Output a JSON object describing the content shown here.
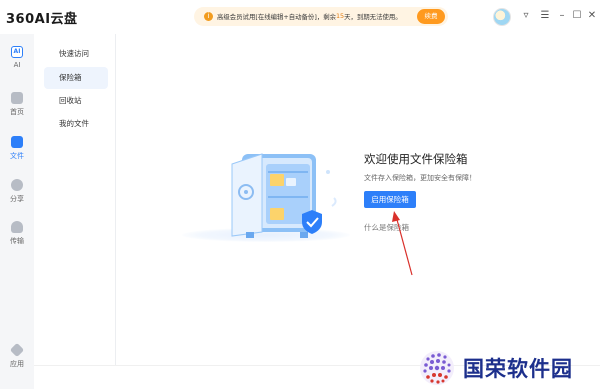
{
  "app": {
    "title": "360AI云盘",
    "accent_color": "#2d7ff9"
  },
  "trial_banner": {
    "icon": "info-icon",
    "prefix": "高级会员试用",
    "features": "[在线编辑+自动备份]",
    "remaining_label": "，剩余",
    "days": "15",
    "days_unit": "天",
    "suffix": "，到期无法使用。",
    "renew_button": "续费"
  },
  "window_controls": {
    "skin": "▿",
    "menu": "☰",
    "minimize": "–",
    "maximize": "☐",
    "close": "✕"
  },
  "rail": {
    "items": [
      {
        "label": "AI",
        "icon": "ai-icon"
      },
      {
        "label": "首页",
        "icon": "home-icon"
      },
      {
        "label": "文件",
        "icon": "folder-icon",
        "active": true
      },
      {
        "label": "分享",
        "icon": "share-icon"
      },
      {
        "label": "传输",
        "icon": "transfer-icon"
      }
    ],
    "apps": {
      "label": "应用",
      "icon": "apps-icon"
    }
  },
  "subnav": {
    "items": [
      {
        "label": "快速访问"
      },
      {
        "label": "保险箱",
        "active": true
      },
      {
        "label": "回收站"
      },
      {
        "label": "我的文件"
      }
    ]
  },
  "vault": {
    "title": "欢迎使用文件保险箱",
    "subtitle": "文件存入保险箱，更加安全有保障！",
    "enable_button": "启用保险箱",
    "what_link": "什么是保险箱"
  },
  "watermark": {
    "text": "国荣软件园"
  }
}
